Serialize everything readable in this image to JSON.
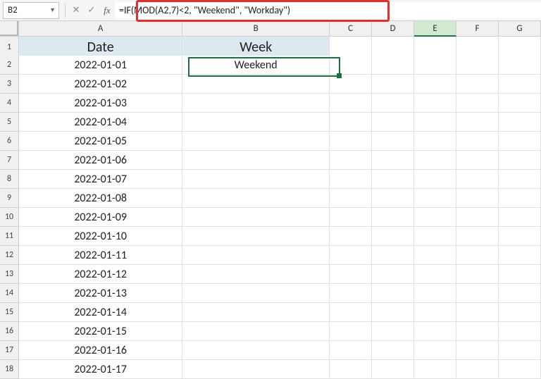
{
  "formula_bar": {
    "cell_ref": "B2",
    "cancel": "✕",
    "confirm": "✓",
    "fx_label": "fx",
    "formula": "=IF(MOD(A2,7)<2, \"Weekend\", \"Workday\")"
  },
  "columns": {
    "A": "A",
    "B": "B",
    "C": "C",
    "D": "D",
    "E": "E",
    "F": "F",
    "G": "G"
  },
  "row_numbers": [
    "1",
    "2",
    "3",
    "4",
    "5",
    "6",
    "7",
    "8",
    "9",
    "10",
    "11",
    "12",
    "13",
    "14",
    "15",
    "16",
    "17",
    "18"
  ],
  "header_row": {
    "A": "Date",
    "B": "Week"
  },
  "data_rows": [
    {
      "A": "2022-01-01",
      "B": "Weekend"
    },
    {
      "A": "2022-01-02",
      "B": ""
    },
    {
      "A": "2022-01-03",
      "B": ""
    },
    {
      "A": "2022-01-04",
      "B": ""
    },
    {
      "A": "2022-01-05",
      "B": ""
    },
    {
      "A": "2022-01-06",
      "B": ""
    },
    {
      "A": "2022-01-07",
      "B": ""
    },
    {
      "A": "2022-01-08",
      "B": ""
    },
    {
      "A": "2022-01-09",
      "B": ""
    },
    {
      "A": "2022-01-10",
      "B": ""
    },
    {
      "A": "2022-01-11",
      "B": ""
    },
    {
      "A": "2022-01-12",
      "B": ""
    },
    {
      "A": "2022-01-13",
      "B": ""
    },
    {
      "A": "2022-01-14",
      "B": ""
    },
    {
      "A": "2022-01-15",
      "B": ""
    },
    {
      "A": "2022-01-16",
      "B": ""
    },
    {
      "A": "2022-01-17",
      "B": ""
    }
  ],
  "selection": {
    "cell": "B2"
  },
  "highlighted_column": "E"
}
